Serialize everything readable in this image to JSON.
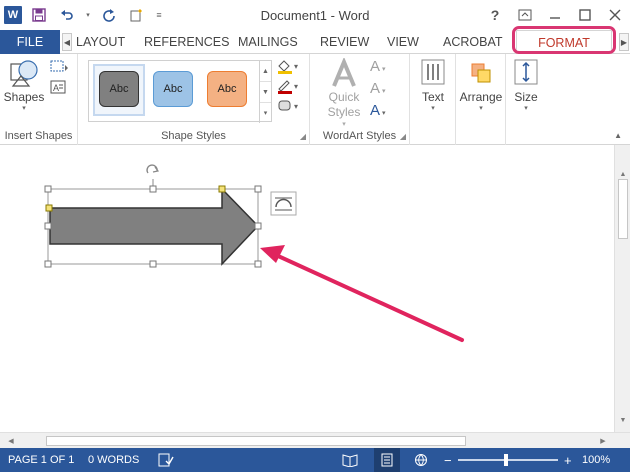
{
  "window": {
    "title": "Document1 - Word",
    "help": "?",
    "controls": [
      "ribbon-display",
      "minimize",
      "maximize",
      "close"
    ]
  },
  "qat": {
    "app_logo": "W",
    "save_icon": "save-icon",
    "undo_icon": "undo-icon",
    "redo_icon": "redo-icon",
    "new_icon": "new-document-icon"
  },
  "tabs": {
    "file": "FILE",
    "items": [
      "LAYOUT",
      "REFERENCES",
      "MAILINGS",
      "REVIEW",
      "VIEW",
      "ACROBAT",
      "FORMAT"
    ],
    "active": "FORMAT"
  },
  "ribbon": {
    "insert_shapes": {
      "label": "Insert Shapes",
      "shapes_button": "Shapes"
    },
    "shape_styles": {
      "label": "Shape Styles",
      "samples": [
        {
          "text": "Abc",
          "color": "#808080"
        },
        {
          "text": "Abc",
          "color": "#9dc3e6"
        },
        {
          "text": "Abc",
          "color": "#f4b183"
        }
      ]
    },
    "wordart_styles": {
      "label": "WordArt Styles",
      "quick_styles": "Quick Styles"
    },
    "text": {
      "label": "Text"
    },
    "arrange": {
      "label": "Arrange"
    },
    "size": {
      "label": "Size"
    }
  },
  "document": {
    "shape": {
      "type": "right-arrow",
      "fill": "#808080",
      "stroke": "#333333"
    },
    "annotation_arrow_color": "#e0245e"
  },
  "status": {
    "page": "PAGE 1 OF 1",
    "words": "0 WORDS",
    "zoom": "100%"
  },
  "colors": {
    "accent": "#2b579a",
    "format_tab": "#c0392b",
    "highlight": "#d93672"
  }
}
